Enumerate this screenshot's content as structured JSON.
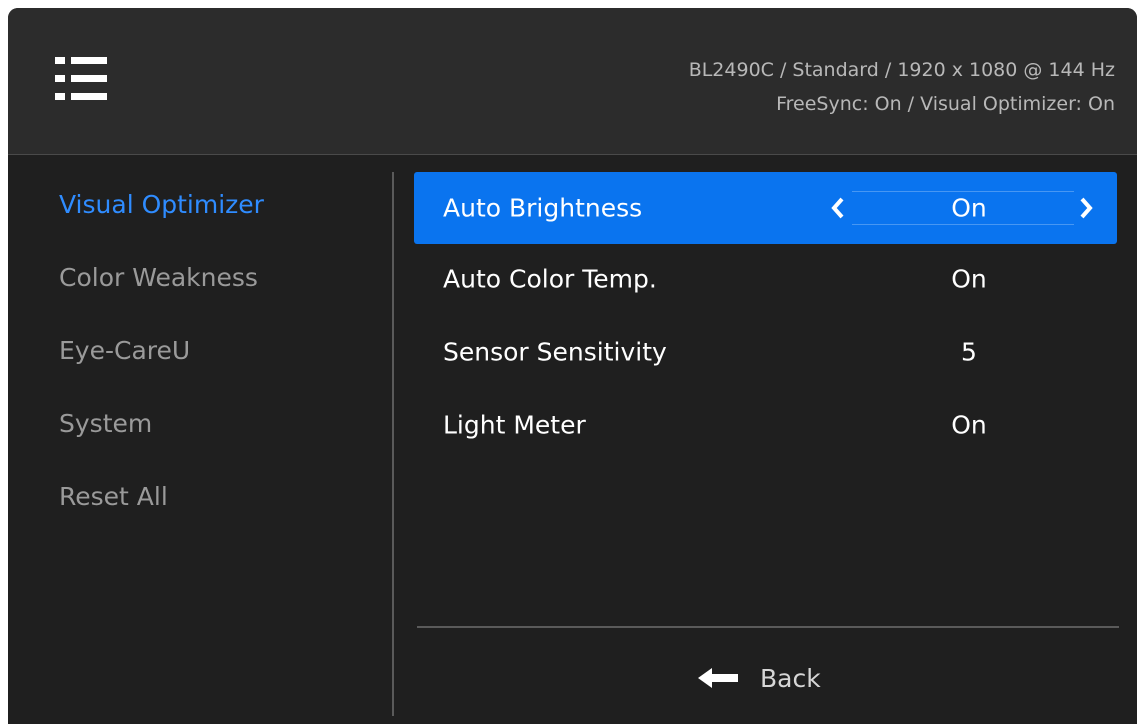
{
  "header": {
    "menu_icon": "list-menu-icon",
    "status_line1": "BL2490C / Standard / 1920 x 1080 @ 144 Hz",
    "status_line2": "FreeSync: On / Visual Optimizer: On"
  },
  "sidebar": {
    "items": [
      {
        "label": "Visual Optimizer",
        "active": true
      },
      {
        "label": "Color Weakness",
        "active": false
      },
      {
        "label": "Eye-CareU",
        "active": false
      },
      {
        "label": "System",
        "active": false
      },
      {
        "label": "Reset All",
        "active": false
      }
    ]
  },
  "settings": {
    "rows": [
      {
        "label": "Auto Brightness",
        "value": "On",
        "selected": true
      },
      {
        "label": "Auto Color Temp.",
        "value": "On",
        "selected": false
      },
      {
        "label": "Sensor Sensitivity",
        "value": "5",
        "selected": false
      },
      {
        "label": "Light Meter",
        "value": "On",
        "selected": false
      }
    ]
  },
  "footer": {
    "back_label": "Back",
    "back_icon": "arrow-left-icon"
  },
  "colors": {
    "accent": "#0a74ef",
    "active_text": "#2f8cff",
    "background": "#1f1f1f",
    "header_background": "#2c2c2c"
  }
}
